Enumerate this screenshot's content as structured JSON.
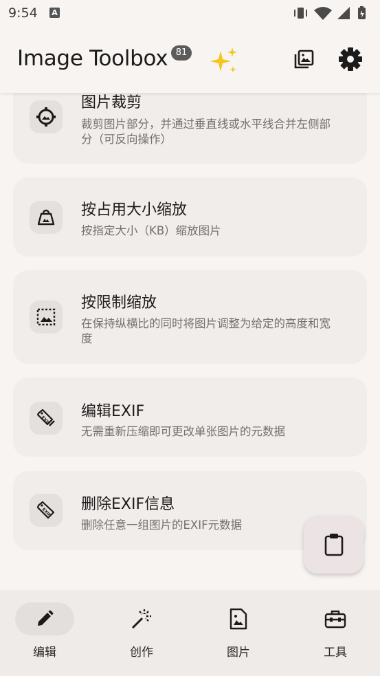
{
  "status": {
    "time": "9:54",
    "a_icon": "A"
  },
  "app": {
    "title": "Image Toolbox",
    "badge": "81"
  },
  "tools": [
    {
      "title": "图片裁剪",
      "desc": "裁剪图片部分，并通过垂直线或水平线合并左侧部分（可反向操作）",
      "icon": "crop-gear-icon"
    },
    {
      "title": "按占用大小缩放",
      "desc": "按指定大小（KB）缩放图片",
      "icon": "weight-icon"
    },
    {
      "title": "按限制缩放",
      "desc": "在保持纵横比的同时将图片调整为给定的高度和宽度",
      "icon": "resize-limit-icon"
    },
    {
      "title": "编辑EXIF",
      "desc": "无需重新压缩即可更改单张图片的元数据",
      "icon": "exif-edit-icon"
    },
    {
      "title": "删除EXIF信息",
      "desc": "删除任意一组图片的EXIF元数据",
      "icon": "exif-tag-icon"
    }
  ],
  "nav": [
    {
      "label": "编辑",
      "icon": "pencil-icon",
      "active": true
    },
    {
      "label": "创作",
      "icon": "magic-wand-icon",
      "active": false
    },
    {
      "label": "图片",
      "icon": "image-file-icon",
      "active": false
    },
    {
      "label": "工具",
      "icon": "toolbox-icon",
      "active": false
    }
  ]
}
